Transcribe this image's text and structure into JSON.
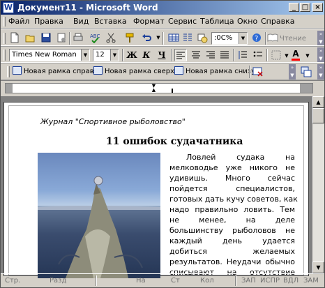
{
  "window": {
    "title": "Документ11 - Microsoft Word",
    "app_icon": "W",
    "minimize": "_",
    "maximize": "□",
    "close": "×"
  },
  "menu": [
    "Файл",
    "Правка",
    "Вид",
    "Вставка",
    "Формат",
    "Сервис",
    "Таблица",
    "Окно",
    "Справка"
  ],
  "standard_toolbar": {
    "zoom": ":0C%",
    "read_label": "Чтение",
    "icons": [
      "new-document-icon",
      "open-icon",
      "save-icon",
      "permission-icon",
      "print-icon",
      "spelling-icon",
      "cut-icon",
      "format-painter-icon",
      "undo-icon",
      "table-icon",
      "columns-icon",
      "help-icon",
      "read-icon"
    ]
  },
  "formatting_toolbar": {
    "font": "Times New Roman",
    "size": "12",
    "bold": "Ж",
    "italic": "К",
    "underline": "Ч",
    "font_color_letter": "A",
    "colors": {
      "font_color": "#ff0000",
      "highlight": "#ffff00"
    }
  },
  "frames_toolbar": {
    "new_frame_right": "Новая рамка справа",
    "new_frame_top": "Новая рамка сверху",
    "new_frame_bottom": "Новая рамка снизу"
  },
  "document": {
    "header": "Журнал \"Спортивное рыболовство\"",
    "title": "11 ошибок судачатника",
    "lines": [
      "Ловлей судака на",
      "мелководье уже никого не",
      "удивишь. Много сейчас",
      "пойдется специалистов,",
      "готовых дать кучу советов, как",
      "надо правильно ловить. Тем",
      "не менее, на деле",
      "большинству рыболовов не",
      "каждый день удается",
      "добиться желаемых",
      "результатов. Неудачи обычно",
      "списывают на отсутствие"
    ]
  },
  "status_bar": [
    "Стр.",
    "Разд",
    "На",
    "Ст",
    "Кол",
    "ЗАП",
    "ИСПР",
    "ВДЛ",
    "ЗАМ"
  ]
}
